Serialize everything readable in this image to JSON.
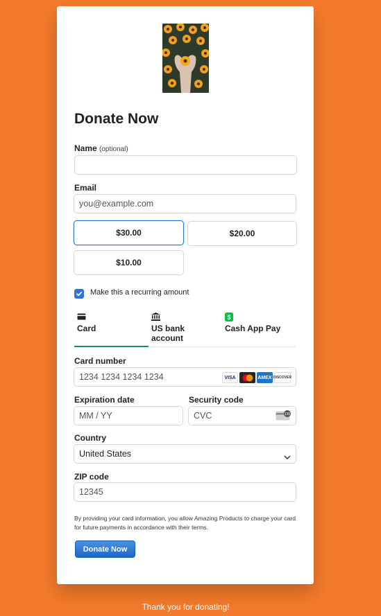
{
  "form": {
    "title": "Donate Now",
    "name_label": "Name",
    "name_optional": "(optional)",
    "name_value": "",
    "email_label": "Email",
    "email_placeholder": "you@example.com",
    "amounts": [
      "$30.00",
      "$20.00",
      "$10.00"
    ],
    "selected_amount": "$30.00",
    "recurring_label": "Make this a recurring amount",
    "recurring_checked": true
  },
  "payment_tabs": [
    {
      "label": "Card",
      "icon": "card-icon",
      "active": true
    },
    {
      "label": "US bank account",
      "icon": "bank-icon",
      "active": false
    },
    {
      "label": "Cash App Pay",
      "icon": "cash-app-icon",
      "active": false
    }
  ],
  "card": {
    "number_label": "Card number",
    "number_placeholder": "1234 1234 1234 1234",
    "brands": [
      "VISA",
      "mastercard",
      "AMEX",
      "DISCOVER"
    ],
    "expiry_label": "Expiration date",
    "expiry_placeholder": "MM / YY",
    "cvc_label": "Security code",
    "cvc_placeholder": "CVC",
    "cvc_icon_text": "135",
    "country_label": "Country",
    "country_value": "United States",
    "zip_label": "ZIP code",
    "zip_placeholder": "12345"
  },
  "legal_text": "By providing your card information, you allow Amazing Products to charge your card for future payments in accordance with their terms.",
  "submit_label": "Donate Now",
  "footer_text": "Thank you for donating!",
  "colors": {
    "background": "#F47B2B",
    "accent": "#2f74d8",
    "active_tab": "#1e8a6a"
  }
}
